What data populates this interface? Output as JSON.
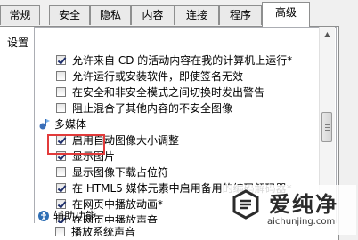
{
  "tabs": [
    {
      "label": "常规",
      "active": false
    },
    {
      "label": "安全",
      "active": false
    },
    {
      "label": "隐私",
      "active": false
    },
    {
      "label": "内容",
      "active": false
    },
    {
      "label": "连接",
      "active": false
    },
    {
      "label": "程序",
      "active": false
    },
    {
      "label": "高级",
      "active": true
    }
  ],
  "settings_label": "设置",
  "list_items": [
    {
      "type": "option",
      "label": "允许来自 CD 的活动内容在我的计算机上运行*",
      "checked": true
    },
    {
      "type": "option",
      "label": "允许运行或安装软件，即使签名无效",
      "checked": false
    },
    {
      "type": "option",
      "label": "在安全和非安全模式之间切换时发出警告",
      "checked": false
    },
    {
      "type": "option",
      "label": "阻止混合了其他内容的不安全图像",
      "checked": false
    },
    {
      "type": "category",
      "label": "多媒体",
      "icon": "multimedia-icon"
    },
    {
      "type": "option",
      "label": "启用自动图像大小调整",
      "checked": true
    },
    {
      "type": "option",
      "label": "显示图片",
      "checked": true
    },
    {
      "type": "option",
      "label": "显示图像下载占位符",
      "checked": false
    },
    {
      "type": "option",
      "label": "在 HTML5 媒体元素中启用备用的编码解码器*",
      "checked": true
    },
    {
      "type": "option",
      "label": "在网页中播放动画*",
      "checked": true
    },
    {
      "type": "option",
      "label": "在网页中播放声音",
      "checked": true
    },
    {
      "type": "category",
      "label": "辅助功能",
      "icon": "accessibility-icon"
    },
    {
      "type": "option",
      "label": "播放系统声音",
      "checked": false
    }
  ],
  "watermark": {
    "title": "爱纯净",
    "url": "aichunjing.com"
  },
  "colors": {
    "highlight": "#e23b3b",
    "check": "#1f2f6b"
  }
}
